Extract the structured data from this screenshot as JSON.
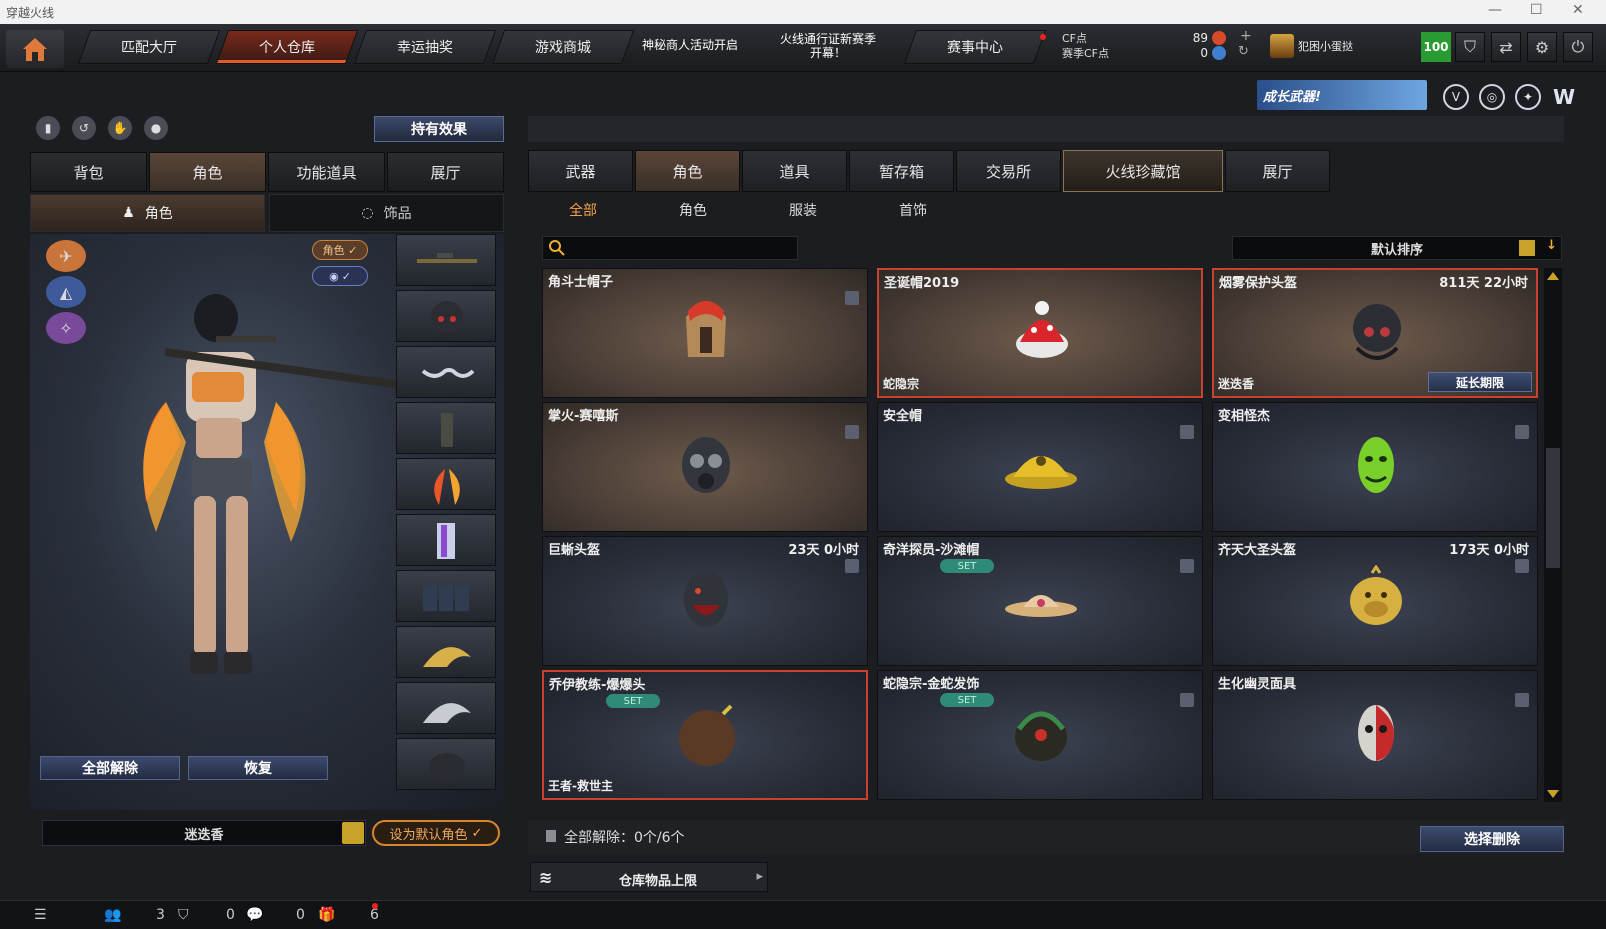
{
  "window": {
    "title": "穿越火线"
  },
  "topnav": {
    "tabs": [
      "匹配大厅",
      "个人仓库",
      "幸运抽奖",
      "游戏商城"
    ],
    "active_tab": "个人仓库",
    "notice1": "神秘商人活动开启",
    "notice2_line1": "火线通行证新赛季",
    "notice2_line2": "开幕！",
    "match_center": "赛事中心",
    "cf_label": "CF点",
    "season_cf_label": "赛季CF点",
    "cf_value": "89",
    "season_cf_value": "0",
    "username": "犯困小蛋挞",
    "level": "100"
  },
  "growth_banner": "成长武器!",
  "left": {
    "holding_button": "持有效果",
    "tabs": [
      "背包",
      "角色",
      "功能道具",
      "展厅"
    ],
    "active_tab": "角色",
    "subtabs": [
      "角色",
      "饰品"
    ],
    "active_subtab": "角色",
    "pill_role": "角色 ✓",
    "pill_eye": "✓",
    "unequip_all": "全部解除",
    "restore": "恢复",
    "character_name": "迷迭香",
    "set_default": "设为默认角色",
    "set_default_check": "✓"
  },
  "right": {
    "tabs": [
      "武器",
      "角色",
      "道具",
      "暂存箱",
      "交易所",
      "火线珍藏馆",
      "展厅"
    ],
    "active_tab": "角色",
    "subtabs": [
      "全部",
      "角色",
      "服装",
      "首饰"
    ],
    "active_subtab": "全部",
    "sort_label": "默认排序",
    "items": [
      {
        "name": "角斗士帽子",
        "time": "",
        "set": false,
        "tag": "",
        "extend": false,
        "selected": false,
        "warm": true,
        "icon": "gladiator-helmet"
      },
      {
        "name": "圣诞帽2019",
        "time": "",
        "set": false,
        "tag": "蛇隐宗",
        "extend": false,
        "selected": true,
        "warm": true,
        "icon": "santa-hat"
      },
      {
        "name": "烟雾保护头盔",
        "time": "811天 22小时",
        "set": false,
        "tag": "迷迭香",
        "extend": true,
        "selected": true,
        "warm": true,
        "icon": "smoke-helmet"
      },
      {
        "name": "掌火-赛嘻斯",
        "time": "",
        "set": false,
        "tag": "",
        "extend": false,
        "selected": false,
        "warm": true,
        "icon": "gas-mask"
      },
      {
        "name": "安全帽",
        "time": "",
        "set": false,
        "tag": "",
        "extend": false,
        "selected": false,
        "warm": false,
        "icon": "hard-hat"
      },
      {
        "name": "变相怪杰",
        "time": "",
        "set": false,
        "tag": "",
        "extend": false,
        "selected": false,
        "warm": false,
        "icon": "green-mask"
      },
      {
        "name": "巨蜥头盔",
        "time": "23天 0小时",
        "set": false,
        "tag": "",
        "extend": false,
        "selected": false,
        "warm": false,
        "icon": "lizard-helmet"
      },
      {
        "name": "奇洋探员-沙滩帽",
        "time": "",
        "set": true,
        "tag": "",
        "extend": false,
        "selected": false,
        "warm": false,
        "icon": "beach-hat"
      },
      {
        "name": "齐天大圣头盔",
        "time": "173天 0小时",
        "set": false,
        "tag": "",
        "extend": false,
        "selected": false,
        "warm": false,
        "icon": "monkey-helmet"
      },
      {
        "name": "乔伊教练-爆爆头",
        "time": "",
        "set": true,
        "tag": "王者-救世主",
        "extend": false,
        "selected": true,
        "warm": false,
        "icon": "afro-bomb"
      },
      {
        "name": "蛇隐宗-金蛇发饰",
        "time": "",
        "set": true,
        "tag": "",
        "extend": false,
        "selected": false,
        "warm": false,
        "icon": "snake-headpiece"
      },
      {
        "name": "生化幽灵面具",
        "time": "",
        "set": false,
        "tag": "",
        "extend": false,
        "selected": false,
        "warm": false,
        "icon": "zombie-mask"
      }
    ],
    "set_label": "SET",
    "extend_label": "延长期限",
    "unequip_all_count": "全部解除：0个/6个",
    "select_delete": "选择删除",
    "capacity": "仓库物品上限"
  },
  "statusbar": {
    "count1": "3",
    "count2": "0",
    "count3": "0",
    "count4": "6"
  },
  "colors": {
    "accent": "#f5a14b",
    "selected_border": "#c8422e",
    "level_bg": "#2a9a32"
  }
}
